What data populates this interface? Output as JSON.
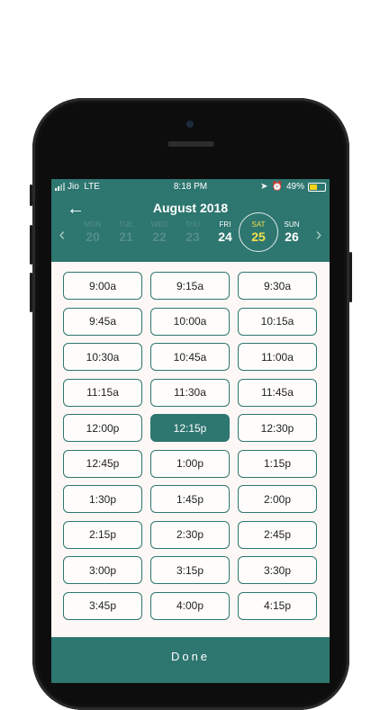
{
  "status_bar": {
    "carrier": "Jio",
    "network": "LTE",
    "time": "8:18 PM",
    "battery": "49%",
    "battery_level": 0.49,
    "battery_color": "#f7d21b"
  },
  "header": {
    "month_title": "August 2018",
    "accent_color": "#2e7670"
  },
  "days": [
    {
      "dow": "MON",
      "num": "20",
      "state": "faded"
    },
    {
      "dow": "TUE",
      "num": "21",
      "state": "faded"
    },
    {
      "dow": "WED",
      "num": "22",
      "state": "faded"
    },
    {
      "dow": "THU",
      "num": "23",
      "state": "faded"
    },
    {
      "dow": "FRI",
      "num": "24",
      "state": "normal"
    },
    {
      "dow": "SAT",
      "num": "25",
      "state": "selected"
    },
    {
      "dow": "SUN",
      "num": "26",
      "state": "normal"
    }
  ],
  "slots": [
    "9:00a",
    "9:15a",
    "9:30a",
    "9:45a",
    "10:00a",
    "10:15a",
    "10:30a",
    "10:45a",
    "11:00a",
    "11:15a",
    "11:30a",
    "11:45a",
    "12:00p",
    "12:15p",
    "12:30p",
    "12:45p",
    "1:00p",
    "1:15p",
    "1:30p",
    "1:45p",
    "2:00p",
    "2:15p",
    "2:30p",
    "2:45p",
    "3:00p",
    "3:15p",
    "3:30p",
    "3:45p",
    "4:00p",
    "4:15p"
  ],
  "selected_slot": "12:15p",
  "done_label": "Done"
}
